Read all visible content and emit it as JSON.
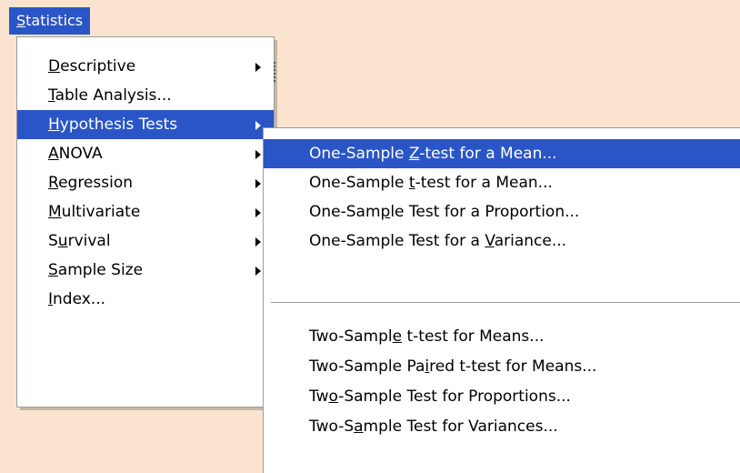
{
  "menubar": {
    "statistics": "Statistics"
  },
  "menu": {
    "items": [
      {
        "pre": "",
        "u": "D",
        "post": "escriptive",
        "arrow": true,
        "active": false
      },
      {
        "pre": "",
        "u": "T",
        "post": "able Analysis...",
        "arrow": false,
        "active": false
      },
      {
        "pre": "",
        "u": "H",
        "post": "ypothesis Tests",
        "arrow": true,
        "active": true
      },
      {
        "pre": "",
        "u": "A",
        "post": "NOVA",
        "arrow": true,
        "active": false
      },
      {
        "pre": "",
        "u": "R",
        "post": "egression",
        "arrow": true,
        "active": false
      },
      {
        "pre": "",
        "u": "M",
        "post": "ultivariate",
        "arrow": true,
        "active": false
      },
      {
        "pre": "S",
        "u": "u",
        "post": "rvival",
        "arrow": true,
        "active": false
      },
      {
        "pre": "",
        "u": "S",
        "post": "ample Size",
        "arrow": true,
        "active": false
      },
      {
        "pre": "",
        "u": "I",
        "post": "ndex...",
        "arrow": false,
        "active": false
      }
    ]
  },
  "submenu": {
    "items": [
      {
        "pre": "One-Sample ",
        "u": "Z",
        "post": "-test for a Mean...",
        "active": true
      },
      {
        "pre": "One-Sample ",
        "u": "t",
        "post": "-test for a Mean...",
        "active": false
      },
      {
        "pre": "One-Sam",
        "u": "p",
        "post": "le Test for a Proportion...",
        "active": false
      },
      {
        "pre": "One-Sample Test for a ",
        "u": "V",
        "post": "ariance...",
        "active": false
      },
      {
        "pre": "Two-Sampl",
        "u": "e",
        "post": " t-test for Means...",
        "active": false
      },
      {
        "pre": "Two-Sample Pa",
        "u": "i",
        "post": "red t-test for Means...",
        "active": false
      },
      {
        "pre": "Tw",
        "u": "o",
        "post": "-Sample Test for Proportions...",
        "active": false
      },
      {
        "pre": "Two-S",
        "u": "a",
        "post": "mple Test for Variances...",
        "active": false
      }
    ]
  }
}
